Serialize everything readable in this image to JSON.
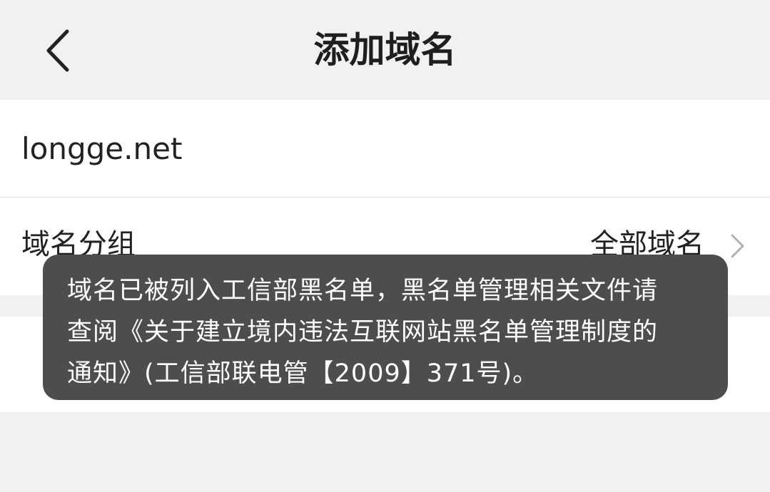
{
  "nav": {
    "title": "添加域名",
    "back_icon": "chevron-left-icon"
  },
  "form": {
    "domain_value": "longge.net",
    "group_label": "域名分组",
    "group_value": "全部域名",
    "group_chevron_icon": "chevron-right-icon"
  },
  "toast": {
    "lines": [
      "域名已被列入工信部黑名单，黑名单管理相关文件请",
      "查阅《关于建立境内违法互联网站黑名单管理制度的",
      "通知》(工信部联电管【2009】371号)。"
    ]
  },
  "colors": {
    "background": "#f1f1f1",
    "card": "#ffffff",
    "toast_background": "#4d4d4d",
    "toast_text": "#ffffff",
    "text": "#222222",
    "chevron": "#b0b0b0"
  }
}
